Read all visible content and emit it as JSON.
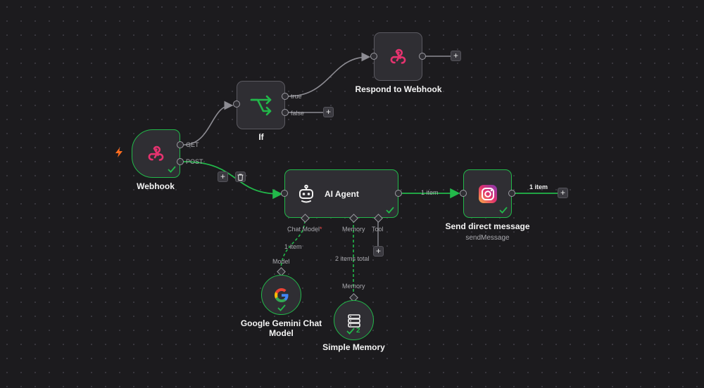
{
  "canvas": {
    "accent_success": "#22b84a",
    "webhook_icon_color": "#e5336f",
    "if_icon_color": "#22b84a",
    "trigger_color": "#ff6d1f"
  },
  "nodes": {
    "webhook": {
      "title": "Webhook",
      "outputs": [
        "GET",
        "POST"
      ],
      "icon": "webhook-icon",
      "status": "success"
    },
    "if": {
      "title": "If",
      "outputs": [
        "true",
        "false"
      ],
      "icon": "branch-icon"
    },
    "respond": {
      "title": "Respond to Webhook",
      "icon": "webhook-icon"
    },
    "agent": {
      "title": "AI Agent",
      "icon": "robot-icon",
      "status": "success",
      "ports": {
        "chat_model": "Chat Model",
        "chat_model_required": "*",
        "memory": "Memory",
        "tool": "Tool"
      }
    },
    "instagram": {
      "title": "Send direct message",
      "subtitle": "sendMessage",
      "icon": "instagram-icon",
      "status": "success"
    },
    "gemini": {
      "title_line1": "Google Gemini Chat",
      "title_line2": "Model",
      "port_label": "Model",
      "icon": "google-icon",
      "status": "success"
    },
    "memory": {
      "title": "Simple Memory",
      "port_label": "Memory",
      "icon": "database-icon",
      "status": "success",
      "run_count": "2"
    }
  },
  "edges": {
    "agent_to_instagram": "1 item",
    "instagram_out": "1 item",
    "gemini_to_agent": "1 item",
    "memory_to_agent": "2 items total"
  },
  "controls": {
    "add_label": "+",
    "delete_icon": "trash-icon"
  }
}
